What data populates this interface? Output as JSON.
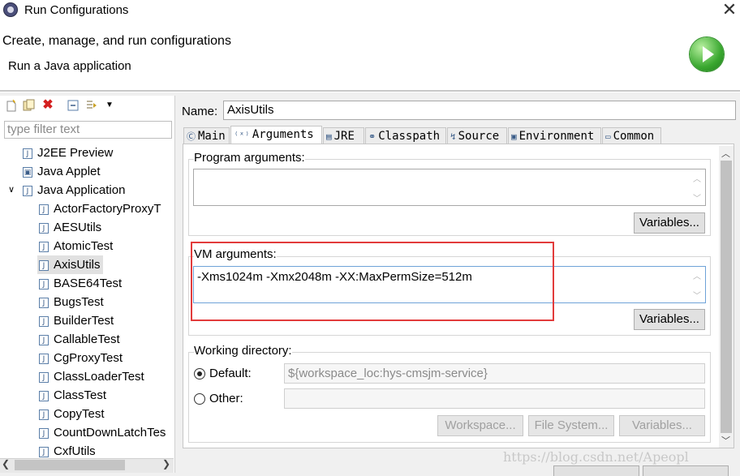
{
  "window": {
    "title": "Run Configurations",
    "close_glyph": "✕"
  },
  "header": {
    "title": "Create, manage, and run configurations",
    "subtitle": "Run a Java application"
  },
  "left": {
    "filter_placeholder": "type filter text",
    "tree": [
      {
        "label": "J2EE Preview",
        "level": 1,
        "icon": "j2ee-icon"
      },
      {
        "label": "Java Applet",
        "level": 1,
        "icon": "applet-icon"
      },
      {
        "label": "Java Application",
        "level": 1,
        "icon": "java-app-icon",
        "expanded": true
      },
      {
        "label": "ActorFactoryProxyT",
        "level": 2
      },
      {
        "label": "AESUtils",
        "level": 2
      },
      {
        "label": "AtomicTest",
        "level": 2
      },
      {
        "label": "AxisUtils",
        "level": 2,
        "selected": true
      },
      {
        "label": "BASE64Test",
        "level": 2
      },
      {
        "label": "BugsTest",
        "level": 2
      },
      {
        "label": "BuilderTest",
        "level": 2
      },
      {
        "label": "CallableTest",
        "level": 2
      },
      {
        "label": "CgProxyTest",
        "level": 2
      },
      {
        "label": "ClassLoaderTest",
        "level": 2
      },
      {
        "label": "ClassTest",
        "level": 2
      },
      {
        "label": "CopyTest",
        "level": 2
      },
      {
        "label": "CountDownLatchTes",
        "level": 2
      },
      {
        "label": "CxfUtils",
        "level": 2
      }
    ]
  },
  "right": {
    "name_label": "Name:",
    "name_value": "AxisUtils",
    "tabs": [
      {
        "label": "Main",
        "icon": "main-icon"
      },
      {
        "label": "Arguments",
        "icon": "arguments-icon",
        "active": true
      },
      {
        "label": "JRE",
        "icon": "jre-icon"
      },
      {
        "label": "Classpath",
        "icon": "classpath-icon"
      },
      {
        "label": "Source",
        "icon": "source-icon"
      },
      {
        "label": "Environment",
        "icon": "environment-icon"
      },
      {
        "label": "Common",
        "icon": "common-icon"
      }
    ],
    "program_args": {
      "label": "Program arguments:",
      "value": "",
      "variables_label": "Variables..."
    },
    "vm_args": {
      "label": "VM arguments:",
      "value": "-Xms1024m -Xmx2048m -XX:MaxPermSize=512m",
      "variables_label": "Variables..."
    },
    "working_dir": {
      "label": "Working directory:",
      "default_label": "Default:",
      "default_value": "${workspace_loc:hys-cmsjm-service}",
      "other_label": "Other:",
      "other_value": "",
      "workspace_btn": "Workspace...",
      "filesystem_btn": "File System...",
      "variables_btn": "Variables..."
    }
  },
  "watermark": "https://blog.csdn.net/Apeopl",
  "colors": {
    "highlight_box": "#e23b3b",
    "run_icon": "#3aa830"
  }
}
